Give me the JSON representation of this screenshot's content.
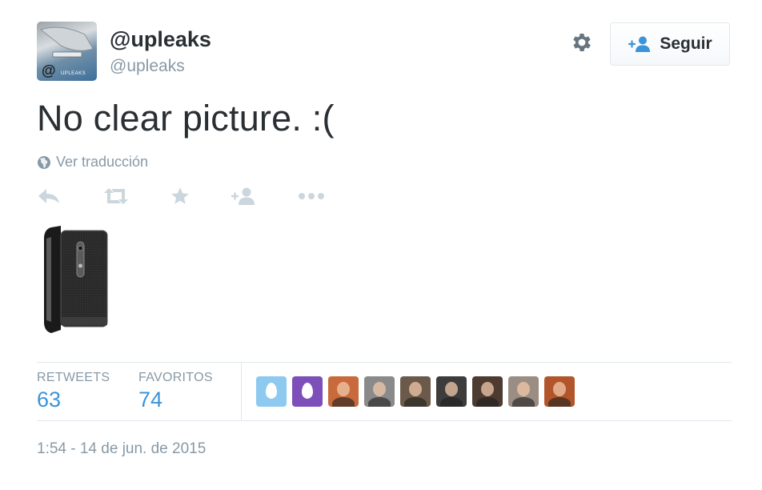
{
  "profile": {
    "display_name": "@upleaks",
    "screen_name": "@upleaks",
    "avatar_text": "@",
    "avatar_tag": "UPLEAKS"
  },
  "header": {
    "settings_icon": "gear-icon",
    "follow_icon": "add-user-icon",
    "follow_label": "Seguir"
  },
  "tweet": {
    "text": "No clear picture. :(",
    "translate_icon": "globe-icon",
    "translate_label": "Ver traducción"
  },
  "actions": [
    "reply-icon",
    "retweet-icon",
    "favorite-icon",
    "follow-user-icon",
    "more-icon"
  ],
  "stats": {
    "retweets_label": "RETWEETS",
    "retweets_count": "63",
    "favorites_label": "FAVORITOS",
    "favorites_count": "74"
  },
  "favoriters": [
    {
      "kind": "egg",
      "color": "#8ec9f0"
    },
    {
      "kind": "egg",
      "color": "#7d4fb8"
    },
    {
      "kind": "photo",
      "color": "#c86a3c"
    },
    {
      "kind": "photo",
      "color": "#8a8a8a"
    },
    {
      "kind": "photo",
      "color": "#6b5a4a"
    },
    {
      "kind": "photo",
      "color": "#3c3c3c"
    },
    {
      "kind": "photo",
      "color": "#4d3a30"
    },
    {
      "kind": "photo",
      "color": "#9c8d84"
    },
    {
      "kind": "photo",
      "color": "#b2552a"
    }
  ],
  "timestamp": "1:54 - 14 de jun. de 2015",
  "colors": {
    "accent": "#3b94d9",
    "muted": "#8899a6",
    "text": "#292f33",
    "border": "#e1e8ed"
  }
}
